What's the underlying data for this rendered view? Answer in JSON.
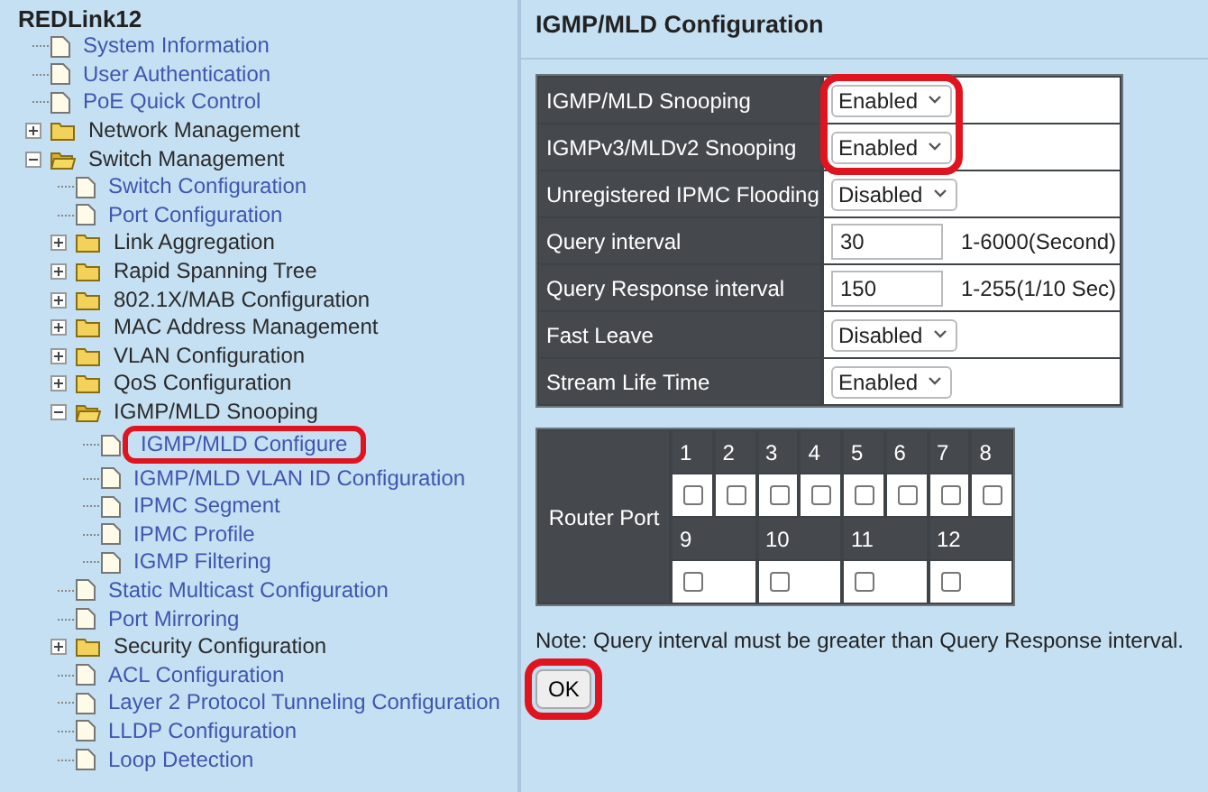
{
  "sidebar": {
    "title": "REDLink12",
    "items": [
      {
        "kind": "page",
        "label": "System Information",
        "highlighted": false
      },
      {
        "kind": "page",
        "label": "User Authentication",
        "highlighted": false
      },
      {
        "kind": "page",
        "label": "PoE Quick Control",
        "highlighted": false
      },
      {
        "kind": "folder",
        "label": "Network Management",
        "expanded": false
      },
      {
        "kind": "folder",
        "label": "Switch Management",
        "expanded": true,
        "children": [
          {
            "kind": "page",
            "label": "Switch Configuration",
            "highlighted": false
          },
          {
            "kind": "page",
            "label": "Port Configuration",
            "highlighted": false
          },
          {
            "kind": "folder",
            "label": "Link Aggregation",
            "expanded": false
          },
          {
            "kind": "folder",
            "label": "Rapid Spanning Tree",
            "expanded": false
          },
          {
            "kind": "folder",
            "label": "802.1X/MAB Configuration",
            "expanded": false
          },
          {
            "kind": "folder",
            "label": "MAC Address Management",
            "expanded": false
          },
          {
            "kind": "folder",
            "label": "VLAN Configuration",
            "expanded": false
          },
          {
            "kind": "folder",
            "label": "QoS Configuration",
            "expanded": false
          },
          {
            "kind": "folder",
            "label": "IGMP/MLD Snooping",
            "expanded": true,
            "children": [
              {
                "kind": "page",
                "label": "IGMP/MLD Configure",
                "highlighted": true
              },
              {
                "kind": "page",
                "label": "IGMP/MLD VLAN ID Configuration",
                "highlighted": false
              },
              {
                "kind": "page",
                "label": "IPMC Segment",
                "highlighted": false
              },
              {
                "kind": "page",
                "label": "IPMC Profile",
                "highlighted": false
              },
              {
                "kind": "page",
                "label": "IGMP Filtering",
                "highlighted": false
              }
            ]
          },
          {
            "kind": "page",
            "label": "Static Multicast Configuration",
            "highlighted": false
          },
          {
            "kind": "page",
            "label": "Port Mirroring",
            "highlighted": false
          },
          {
            "kind": "folder",
            "label": "Security Configuration",
            "expanded": false
          },
          {
            "kind": "page",
            "label": "ACL Configuration",
            "highlighted": false
          },
          {
            "kind": "page",
            "label": "Layer 2 Protocol Tunneling Configuration",
            "highlighted": false
          },
          {
            "kind": "page",
            "label": "LLDP Configuration",
            "highlighted": false
          },
          {
            "kind": "page",
            "label": "Loop Detection",
            "highlighted": false
          }
        ]
      }
    ]
  },
  "page": {
    "title": "IGMP/MLD Configuration",
    "settings": [
      {
        "kind": "select",
        "label": "IGMP/MLD Snooping",
        "value": "Enabled",
        "highlighted": true
      },
      {
        "kind": "select",
        "label": "IGMPv3/MLDv2 Snooping",
        "value": "Enabled",
        "highlighted": true
      },
      {
        "kind": "select",
        "label": "Unregistered IPMC Flooding",
        "value": "Disabled",
        "highlighted": false
      },
      {
        "kind": "number",
        "label": "Query interval",
        "value": "30",
        "range": "1-6000(Second)",
        "highlighted": false
      },
      {
        "kind": "number",
        "label": "Query Response interval",
        "value": "150",
        "range": "1-255(1/10 Sec)",
        "highlighted": false
      },
      {
        "kind": "select",
        "label": "Fast Leave",
        "value": "Disabled",
        "highlighted": false
      },
      {
        "kind": "select",
        "label": "Stream Life Time",
        "value": "Enabled",
        "highlighted": false
      }
    ],
    "router_port": {
      "label": "Router Port",
      "port_rows": [
        [
          {
            "label": "1",
            "checked": false
          },
          {
            "label": "2",
            "checked": false
          },
          {
            "label": "3",
            "checked": false
          },
          {
            "label": "4",
            "checked": false
          },
          {
            "label": "5",
            "checked": false
          },
          {
            "label": "6",
            "checked": false
          },
          {
            "label": "7",
            "checked": false
          },
          {
            "label": "8",
            "checked": false
          }
        ],
        [
          {
            "label": "9",
            "checked": false
          },
          {
            "label": "10",
            "checked": false
          },
          {
            "label": "11",
            "checked": false
          },
          {
            "label": "12",
            "checked": false
          }
        ]
      ]
    },
    "note": "Note: Query interval must be greater than Query Response interval.",
    "ok_button": {
      "label": "OK",
      "highlighted": true
    }
  }
}
